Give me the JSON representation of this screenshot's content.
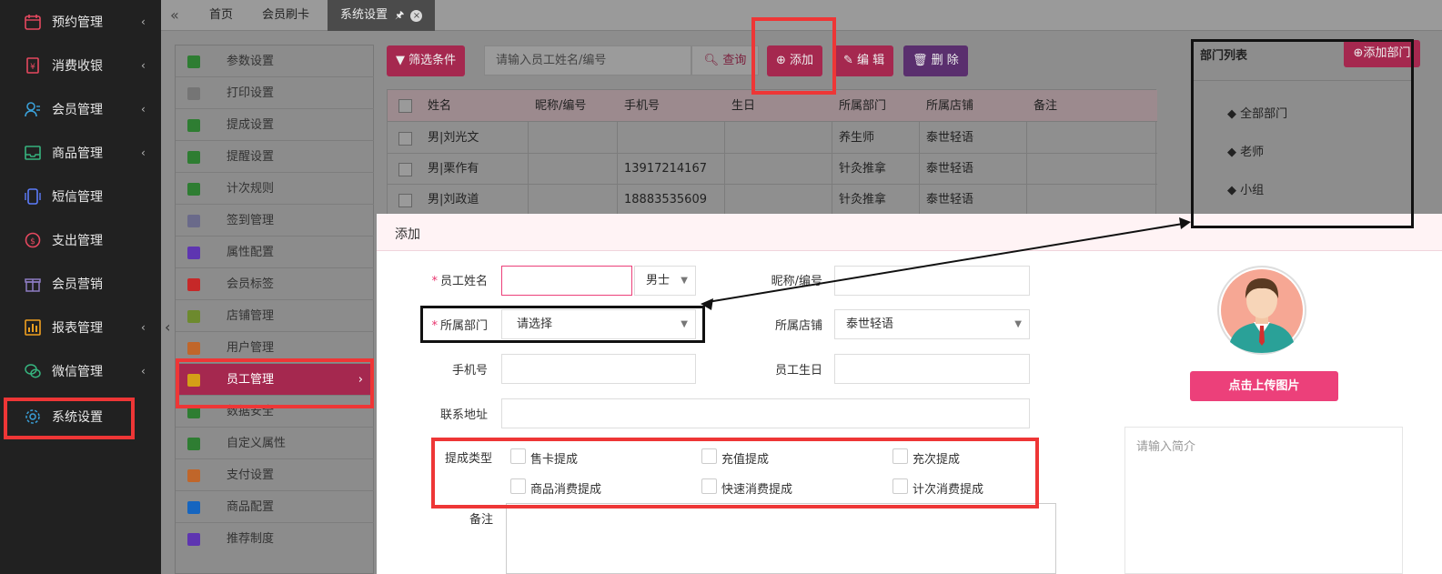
{
  "sidebar": {
    "items": [
      {
        "label": "预约管理",
        "has_arrow": true
      },
      {
        "label": "消费收银",
        "has_arrow": true
      },
      {
        "label": "会员管理",
        "has_arrow": true
      },
      {
        "label": "商品管理",
        "has_arrow": true
      },
      {
        "label": "短信管理",
        "has_arrow": false
      },
      {
        "label": "支出管理",
        "has_arrow": false
      },
      {
        "label": "会员营销",
        "has_arrow": false
      },
      {
        "label": "报表管理",
        "has_arrow": true
      },
      {
        "label": "微信管理",
        "has_arrow": true
      },
      {
        "label": "系统设置",
        "has_arrow": false
      }
    ],
    "arrow_glyph": "‹"
  },
  "tabs": {
    "back_glyph": "«",
    "items": [
      {
        "label": "首页"
      },
      {
        "label": "会员刷卡"
      },
      {
        "label": "系统设置",
        "active": true
      }
    ]
  },
  "subnav": {
    "items": [
      {
        "label": "参数设置",
        "color": "#2e7d32"
      },
      {
        "label": "打印设置",
        "color": "#757575"
      },
      {
        "label": "提成设置",
        "color": "#2e7d32"
      },
      {
        "label": "提醒设置",
        "color": "#2e7d32"
      },
      {
        "label": "计次规则",
        "color": "#2e7d32"
      },
      {
        "label": "签到管理",
        "color": "#6a6a8a"
      },
      {
        "label": "属性配置",
        "color": "#5e35b1"
      },
      {
        "label": "会员标签",
        "color": "#c62828"
      },
      {
        "label": "店铺管理",
        "color": "#6d8a2e"
      },
      {
        "label": "用户管理",
        "color": "#c0662a"
      },
      {
        "label": "员工管理",
        "color": "#d4a017",
        "active": true
      },
      {
        "label": "数据安全",
        "color": "#2e7d32"
      },
      {
        "label": "自定义属性",
        "color": "#2e7d32"
      },
      {
        "label": "支付设置",
        "color": "#c0662a"
      },
      {
        "label": "商品配置",
        "color": "#1565c0"
      },
      {
        "label": "推荐制度",
        "color": "#5e35b1"
      }
    ],
    "collapse_glyph": "‹"
  },
  "toolbar": {
    "filter_label": "筛选条件",
    "search_placeholder": "请输入员工姓名/编号",
    "search_label": "查询",
    "add_label": "添加",
    "edit_label": "编 辑",
    "delete_label": "删 除"
  },
  "grid": {
    "headers": [
      "姓名",
      "昵称/编号",
      "手机号",
      "生日",
      "所属部门",
      "所属店铺",
      "备注"
    ],
    "rows": [
      [
        "男|刘光文",
        "",
        "",
        "",
        "养生师",
        "泰世轻语",
        ""
      ],
      [
        "男|栗作有",
        "",
        "13917214167",
        "",
        "针灸推拿",
        "泰世轻语",
        ""
      ],
      [
        "男|刘政道",
        "",
        "18883535609",
        "",
        "针灸推拿",
        "泰世轻语",
        ""
      ]
    ]
  },
  "dept": {
    "title": "部门列表",
    "add_label": "添加部门",
    "items": [
      "全部部门",
      "老师",
      "小组"
    ]
  },
  "modal": {
    "title": "添加",
    "name_label": "员工姓名",
    "gender_value": "男士",
    "nickname_label": "昵称/编号",
    "dept_label": "所属部门",
    "dept_value": "请选择",
    "store_label": "所属店铺",
    "store_value": "泰世轻语",
    "phone_label": "手机号",
    "birthday_label": "员工生日",
    "address_label": "联系地址",
    "commission_label": "提成类型",
    "commission_types": [
      "售卡提成",
      "充值提成",
      "充次提成",
      "商品消费提成",
      "快速消费提成",
      "计次消费提成"
    ],
    "remark_label": "备注",
    "upload_label": "点击上传图片",
    "intro_placeholder": "请输入简介"
  },
  "colors": {
    "accent": "#ec407a",
    "overlay_accent": "#a5284f",
    "annotation_red": "#ee3636",
    "annotation_black": "#111111"
  }
}
